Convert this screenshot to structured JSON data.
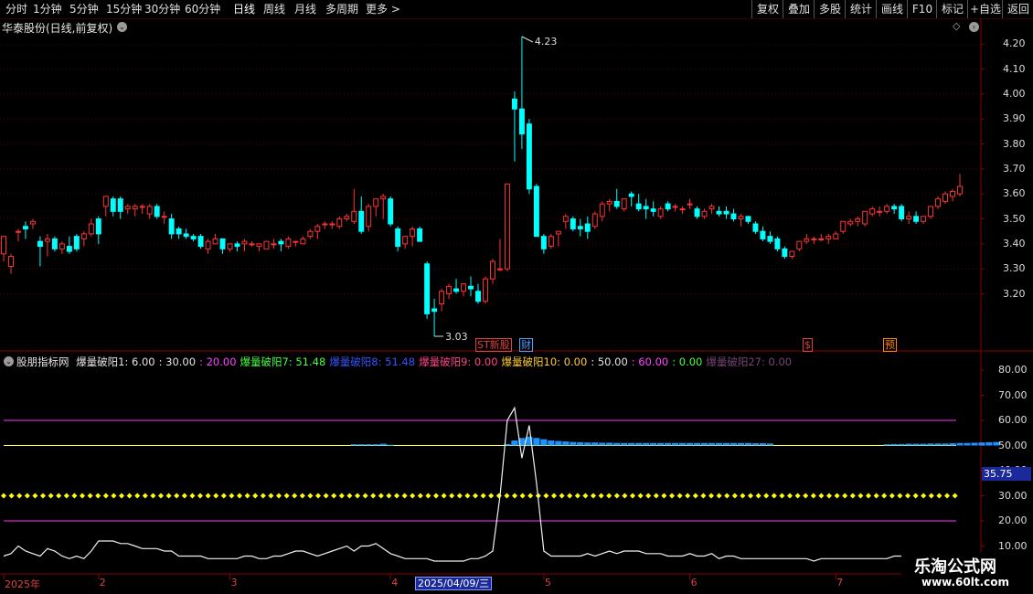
{
  "toolbar": {
    "periods": [
      "分时",
      "1分钟",
      "5分钟",
      "15分钟",
      "30分钟",
      "60分钟",
      "日线",
      "周线",
      "月线",
      "多周期",
      "更多 >"
    ],
    "active_period": "日线",
    "right_buttons": [
      "复权",
      "叠加",
      "多股",
      "统计",
      "画线",
      "F10",
      "标记",
      "+自选",
      "返回"
    ]
  },
  "main_panel": {
    "title": "华泰股份(日线,前复权)",
    "high_marker": "4.23",
    "low_marker": "3.03",
    "y_ticks": [
      "4.20",
      "4.10",
      "4.00",
      "3.90",
      "3.80",
      "3.70",
      "3.60",
      "3.50",
      "3.40",
      "3.30",
      "3.20"
    ],
    "events": [
      {
        "label": "ST新股",
        "color": "#e04040"
      },
      {
        "label": "财",
        "color": "#4aa0ff"
      },
      {
        "label": "$",
        "color": "#e04040"
      },
      {
        "label": "预",
        "color": "#ff8800"
      }
    ],
    "candles": [
      [
        3.36,
        3.43,
        3.33,
        3.43
      ],
      [
        3.31,
        3.36,
        3.28,
        3.35
      ],
      [
        3.45,
        3.46,
        3.41,
        3.45
      ],
      [
        3.47,
        3.49,
        3.42,
        3.46
      ],
      [
        3.48,
        3.5,
        3.46,
        3.49
      ],
      [
        3.41,
        3.43,
        3.31,
        3.39
      ],
      [
        3.41,
        3.44,
        3.35,
        3.42
      ],
      [
        3.42,
        3.43,
        3.37,
        3.38
      ],
      [
        3.38,
        3.41,
        3.36,
        3.4
      ],
      [
        3.39,
        3.43,
        3.36,
        3.37
      ],
      [
        3.43,
        3.44,
        3.37,
        3.38
      ],
      [
        3.42,
        3.45,
        3.39,
        3.44
      ],
      [
        3.44,
        3.5,
        3.43,
        3.48
      ],
      [
        3.5,
        3.51,
        3.4,
        3.44
      ],
      [
        3.55,
        3.59,
        3.51,
        3.59
      ],
      [
        3.58,
        3.59,
        3.51,
        3.53
      ],
      [
        3.58,
        3.59,
        3.5,
        3.53
      ],
      [
        3.54,
        3.56,
        3.52,
        3.55
      ],
      [
        3.54,
        3.56,
        3.51,
        3.55
      ],
      [
        3.55,
        3.56,
        3.52,
        3.55
      ],
      [
        3.52,
        3.56,
        3.5,
        3.55
      ],
      [
        3.55,
        3.56,
        3.5,
        3.51
      ],
      [
        3.51,
        3.53,
        3.48,
        3.51
      ],
      [
        3.5,
        3.52,
        3.42,
        3.44
      ],
      [
        3.46,
        3.47,
        3.42,
        3.44
      ],
      [
        3.44,
        3.46,
        3.42,
        3.43
      ],
      [
        3.43,
        3.44,
        3.41,
        3.42
      ],
      [
        3.43,
        3.44,
        3.38,
        3.39
      ],
      [
        3.38,
        3.42,
        3.36,
        3.41
      ],
      [
        3.4,
        3.44,
        3.4,
        3.42
      ],
      [
        3.42,
        3.42,
        3.36,
        3.38
      ],
      [
        3.38,
        3.4,
        3.37,
        3.4
      ],
      [
        3.4,
        3.41,
        3.37,
        3.39
      ],
      [
        3.4,
        3.42,
        3.37,
        3.41
      ],
      [
        3.4,
        3.41,
        3.39,
        3.4
      ],
      [
        3.39,
        3.4,
        3.37,
        3.4
      ],
      [
        3.38,
        3.41,
        3.38,
        3.41
      ],
      [
        3.4,
        3.42,
        3.38,
        3.4
      ],
      [
        3.41,
        3.42,
        3.37,
        3.4
      ],
      [
        3.39,
        3.43,
        3.38,
        3.42
      ],
      [
        3.41,
        3.41,
        3.39,
        3.41
      ],
      [
        3.4,
        3.43,
        3.4,
        3.42
      ],
      [
        3.43,
        3.46,
        3.42,
        3.45
      ],
      [
        3.45,
        3.48,
        3.42,
        3.47
      ],
      [
        3.48,
        3.49,
        3.46,
        3.48
      ],
      [
        3.48,
        3.49,
        3.46,
        3.48
      ],
      [
        3.47,
        3.51,
        3.46,
        3.5
      ],
      [
        3.5,
        3.52,
        3.49,
        3.51
      ],
      [
        3.49,
        3.62,
        3.48,
        3.53
      ],
      [
        3.53,
        3.59,
        3.44,
        3.45
      ],
      [
        3.47,
        3.56,
        3.45,
        3.55
      ],
      [
        3.55,
        3.58,
        3.51,
        3.58
      ],
      [
        3.58,
        3.6,
        3.5,
        3.59
      ],
      [
        3.58,
        3.59,
        3.47,
        3.48
      ],
      [
        3.46,
        3.47,
        3.37,
        3.39
      ],
      [
        3.4,
        3.43,
        3.38,
        3.43
      ],
      [
        3.43,
        3.47,
        3.39,
        3.46
      ],
      [
        3.46,
        3.47,
        3.41,
        3.41
      ],
      [
        3.32,
        3.33,
        3.1,
        3.12
      ],
      [
        3.14,
        3.18,
        3.03,
        3.13
      ],
      [
        3.16,
        3.22,
        3.13,
        3.21
      ],
      [
        3.2,
        3.24,
        3.18,
        3.23
      ],
      [
        3.22,
        3.26,
        3.2,
        3.21
      ],
      [
        3.21,
        3.23,
        3.19,
        3.24
      ],
      [
        3.23,
        3.27,
        3.19,
        3.22
      ],
      [
        3.21,
        3.24,
        3.16,
        3.17
      ],
      [
        3.17,
        3.27,
        3.16,
        3.26
      ],
      [
        3.26,
        3.34,
        3.24,
        3.33
      ],
      [
        3.3,
        3.42,
        3.29,
        3.3
      ],
      [
        3.3,
        3.62,
        3.29,
        3.64
      ],
      [
        3.98,
        4.01,
        3.73,
        3.94
      ],
      [
        3.94,
        4.23,
        3.78,
        3.84
      ],
      [
        3.88,
        3.9,
        3.6,
        3.62
      ],
      [
        3.63,
        3.64,
        3.43,
        3.43
      ],
      [
        3.43,
        3.44,
        3.36,
        3.38
      ],
      [
        3.39,
        3.44,
        3.38,
        3.43
      ],
      [
        3.44,
        3.45,
        3.39,
        3.45
      ],
      [
        3.49,
        3.52,
        3.46,
        3.51
      ],
      [
        3.5,
        3.51,
        3.45,
        3.46
      ],
      [
        3.47,
        3.5,
        3.43,
        3.46
      ],
      [
        3.48,
        3.51,
        3.42,
        3.45
      ],
      [
        3.47,
        3.53,
        3.46,
        3.52
      ],
      [
        3.51,
        3.57,
        3.49,
        3.56
      ],
      [
        3.56,
        3.58,
        3.53,
        3.57
      ],
      [
        3.57,
        3.62,
        3.54,
        3.55
      ],
      [
        3.54,
        3.57,
        3.53,
        3.58
      ],
      [
        3.6,
        3.61,
        3.55,
        3.59
      ],
      [
        3.56,
        3.6,
        3.53,
        3.54
      ],
      [
        3.55,
        3.58,
        3.5,
        3.54
      ],
      [
        3.54,
        3.57,
        3.51,
        3.53
      ],
      [
        3.51,
        3.55,
        3.5,
        3.54
      ],
      [
        3.56,
        3.57,
        3.53,
        3.54
      ],
      [
        3.55,
        3.56,
        3.53,
        3.55
      ],
      [
        3.54,
        3.55,
        3.52,
        3.54
      ],
      [
        3.56,
        3.58,
        3.54,
        3.56
      ],
      [
        3.54,
        3.55,
        3.5,
        3.51
      ],
      [
        3.51,
        3.54,
        3.5,
        3.53
      ],
      [
        3.54,
        3.56,
        3.52,
        3.55
      ],
      [
        3.53,
        3.55,
        3.51,
        3.52
      ],
      [
        3.53,
        3.55,
        3.5,
        3.52
      ],
      [
        3.52,
        3.54,
        3.49,
        3.5
      ],
      [
        3.5,
        3.52,
        3.47,
        3.51
      ],
      [
        3.51,
        3.51,
        3.48,
        3.49
      ],
      [
        3.48,
        3.49,
        3.44,
        3.45
      ],
      [
        3.45,
        3.47,
        3.41,
        3.42
      ],
      [
        3.43,
        3.45,
        3.4,
        3.41
      ],
      [
        3.42,
        3.43,
        3.37,
        3.38
      ],
      [
        3.38,
        3.39,
        3.34,
        3.35
      ],
      [
        3.35,
        3.37,
        3.34,
        3.37
      ],
      [
        3.38,
        3.41,
        3.37,
        3.41
      ],
      [
        3.41,
        3.44,
        3.4,
        3.42
      ],
      [
        3.42,
        3.43,
        3.4,
        3.42
      ],
      [
        3.42,
        3.44,
        3.41,
        3.42
      ],
      [
        3.42,
        3.44,
        3.4,
        3.43
      ],
      [
        3.42,
        3.45,
        3.42,
        3.44
      ],
      [
        3.45,
        3.49,
        3.44,
        3.49
      ],
      [
        3.48,
        3.5,
        3.47,
        3.49
      ],
      [
        3.49,
        3.51,
        3.47,
        3.5
      ],
      [
        3.48,
        3.53,
        3.47,
        3.53
      ],
      [
        3.52,
        3.55,
        3.51,
        3.54
      ],
      [
        3.53,
        3.55,
        3.51,
        3.53
      ],
      [
        3.53,
        3.56,
        3.52,
        3.55
      ],
      [
        3.55,
        3.56,
        3.52,
        3.54
      ],
      [
        3.55,
        3.56,
        3.49,
        3.5
      ],
      [
        3.5,
        3.53,
        3.48,
        3.51
      ],
      [
        3.51,
        3.53,
        3.48,
        3.49
      ],
      [
        3.49,
        3.51,
        3.48,
        3.51
      ],
      [
        3.51,
        3.55,
        3.5,
        3.55
      ],
      [
        3.55,
        3.59,
        3.54,
        3.58
      ],
      [
        3.57,
        3.61,
        3.56,
        3.6
      ],
      [
        3.59,
        3.62,
        3.57,
        3.61
      ],
      [
        3.6,
        3.68,
        3.59,
        3.63
      ]
    ]
  },
  "indicator_panel": {
    "title": "股朋指标网",
    "params": [
      {
        "text": "爆量破阳1: 6.00",
        "color": "#e6e6e6"
      },
      {
        "text": ": 30.00",
        "color": "#e6e6e6"
      },
      {
        "text": ": 20.00",
        "color": "#ff44ff"
      },
      {
        "text": "爆量破阳7: 51.48",
        "color": "#44ff44"
      },
      {
        "text": "爆量破阳8: 51.48",
        "color": "#3355ff"
      },
      {
        "text": "爆量破阳9: 0.00",
        "color": "#ff4488"
      },
      {
        "text": "爆量破阳10: 0.00",
        "color": "#ffcc33"
      },
      {
        "text": ": 50.00",
        "color": "#e6e6e6"
      },
      {
        "text": ": 60.00",
        "color": "#ff44ff"
      },
      {
        "text": ": 0.00",
        "color": "#44ff44"
      },
      {
        "text": "爆量破阳27: 0.00",
        "color": "#774477"
      }
    ],
    "y_ticks": [
      "80.00",
      "70.00",
      "60.00",
      "50.00",
      "40.00",
      "30.00",
      "20.00",
      "10.00"
    ],
    "current_value": "35.75",
    "hlines": [
      {
        "value": 60,
        "color": "#ff33ff"
      },
      {
        "value": 50,
        "color": "#ffff44"
      },
      {
        "value": 30,
        "color": "#ffff00",
        "style": "diamond"
      },
      {
        "value": 20,
        "color": "#ff33ff"
      }
    ],
    "series_line": [
      6,
      7,
      10,
      8,
      7,
      6,
      9,
      8,
      6,
      5,
      6,
      5,
      8,
      12,
      12,
      12,
      11,
      11,
      10,
      9,
      9,
      9,
      8,
      8,
      6,
      6,
      6,
      6,
      5,
      5,
      5,
      5,
      5,
      6,
      6,
      5,
      5,
      6,
      6,
      7,
      8,
      8,
      7,
      6,
      7,
      8,
      9,
      10,
      8,
      10,
      10,
      11,
      9,
      7,
      6,
      5,
      5,
      5,
      5,
      4,
      4,
      4,
      4,
      4,
      5,
      5,
      6,
      8,
      30,
      60,
      65,
      45,
      58,
      35,
      8,
      6,
      6,
      6,
      6,
      6,
      7,
      6,
      7,
      8,
      7,
      8,
      8,
      8,
      7,
      7,
      7,
      6,
      6,
      6,
      7,
      6,
      6,
      7,
      5,
      6,
      6,
      5,
      5,
      5,
      5,
      5,
      5,
      5,
      5,
      5,
      5,
      4,
      5,
      5,
      5,
      5,
      5,
      5,
      5,
      5,
      5,
      5,
      6,
      6,
      6,
      6,
      6,
      6,
      7,
      6,
      6,
      6
    ],
    "bars": [
      0,
      0,
      0,
      0,
      0,
      0,
      0,
      0,
      0,
      0,
      0,
      0,
      0,
      0,
      0,
      0,
      0,
      0,
      0,
      0,
      0,
      0,
      0,
      0,
      0,
      0,
      0,
      0,
      0,
      0,
      0,
      0,
      0,
      0,
      0,
      0,
      0,
      0,
      0,
      0,
      0,
      0,
      0,
      0,
      0,
      0,
      0,
      0,
      50.5,
      50.5,
      50.5,
      50.5,
      50.7,
      50.3,
      0,
      0,
      0,
      0,
      0,
      0,
      0,
      0,
      0,
      0,
      0,
      0,
      0,
      0,
      0,
      50.6,
      52,
      53,
      53.5,
      53,
      52.5,
      52,
      51.8,
      51.6,
      51.4,
      51.3,
      51.2,
      51.2,
      51.1,
      51.1,
      51,
      51,
      51,
      51,
      51,
      51,
      51,
      51,
      51,
      51,
      51,
      51,
      51,
      51,
      51,
      51,
      51,
      51,
      51,
      50.9,
      50.9,
      50.8,
      0,
      0,
      0,
      0,
      0,
      0,
      0,
      0,
      0,
      0,
      0,
      0,
      0,
      0,
      0,
      50.5,
      50.6,
      50.6,
      50.7,
      50.7,
      50.7,
      50.8,
      50.8,
      50.8,
      50.9,
      51,
      51,
      51.1,
      51.2,
      51.3,
      51.4
    ]
  },
  "date_axis": {
    "labels": [
      {
        "text": "2025年",
        "index": 0
      },
      {
        "text": "2",
        "index": 13
      },
      {
        "text": "3",
        "index": 31
      },
      {
        "text": "4",
        "index": 53
      },
      {
        "text": "5",
        "index": 74
      },
      {
        "text": "6",
        "index": 94
      },
      {
        "text": "7",
        "index": 114
      }
    ],
    "cursor_date": "2025/04/09/三"
  },
  "watermark": {
    "line1": "乐淘公式网",
    "line2": "www.60lt.com"
  },
  "colors": {
    "up": "#ff3333",
    "down": "#00ffff",
    "grid": "#4a0000",
    "axis": "#8b0000",
    "bar": "#1e90ff"
  }
}
